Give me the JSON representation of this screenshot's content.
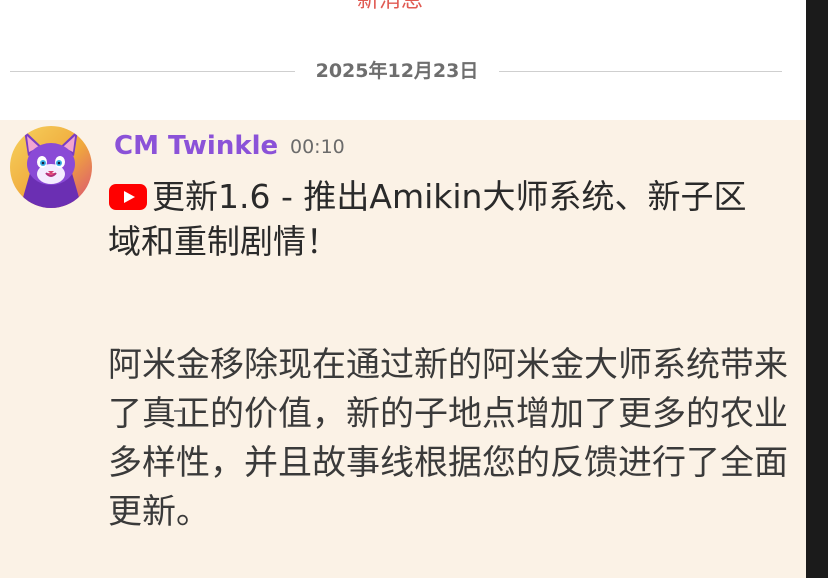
{
  "top_banner": "新消息",
  "date_divider": "2025年12月23日",
  "message": {
    "author": "CM Twinkle",
    "timestamp": "00:10",
    "title_icon": "youtube-icon",
    "title": "更新1.6 - 推出Amikin大师系统、新子区域和重制剧情！",
    "body": "阿米金移除现在通过新的阿米金大师系统带来了真正的价值，新的子地点增加了更多的农业多样性，并且故事线根据您的反馈进行了全面更新。"
  },
  "colors": {
    "author": "#8b52d8",
    "message_bg": "#fbf2e6",
    "banner": "#e05a52",
    "youtube": "#ff0000"
  }
}
